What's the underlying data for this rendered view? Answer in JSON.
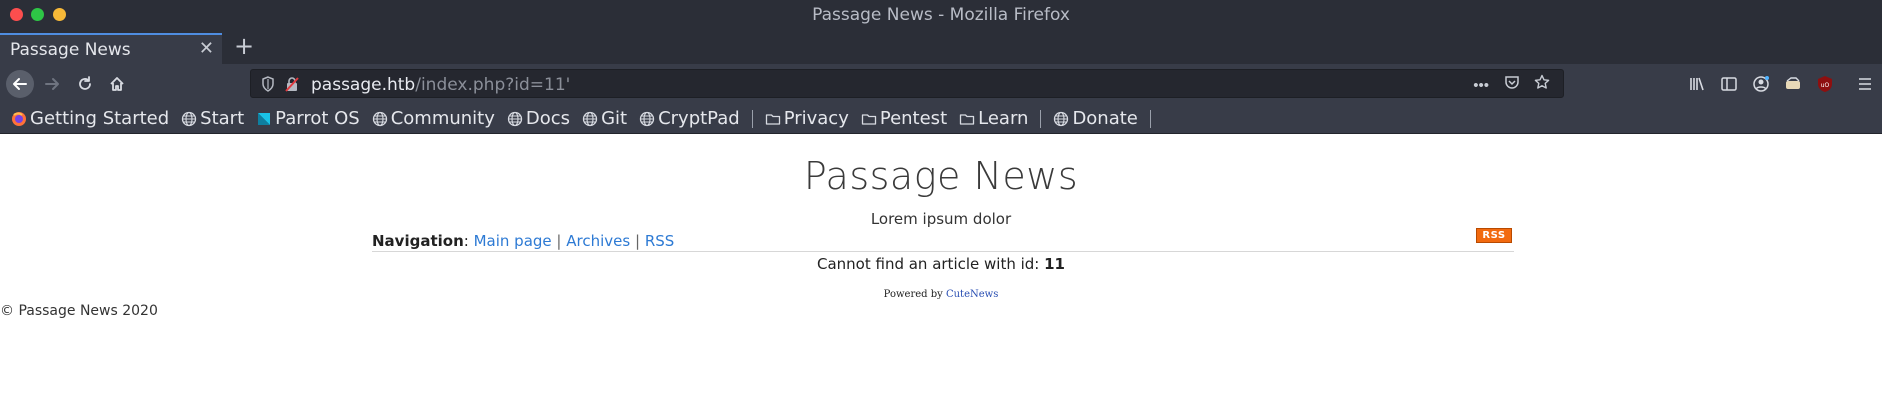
{
  "window": {
    "title": "Passage News - Mozilla Firefox"
  },
  "tab": {
    "title": "Passage News",
    "close_glyph": "✕",
    "new_tab_glyph": "+"
  },
  "toolbar": {
    "url_host": "passage.htb",
    "url_path": "/index.php?id=11'",
    "page_actions_glyph": "•••"
  },
  "bookmarks": {
    "items": [
      {
        "label": "Getting Started",
        "icon": "firefox-icon"
      },
      {
        "label": "Start",
        "icon": "globe-icon"
      },
      {
        "label": "Parrot OS",
        "icon": "parrot-icon"
      },
      {
        "label": "Community",
        "icon": "globe-icon"
      },
      {
        "label": "Docs",
        "icon": "globe-icon"
      },
      {
        "label": "Git",
        "icon": "globe-icon"
      },
      {
        "label": "CryptPad",
        "icon": "globe-icon"
      },
      {
        "label": "Privacy",
        "icon": "folder-icon"
      },
      {
        "label": "Pentest",
        "icon": "folder-icon"
      },
      {
        "label": "Learn",
        "icon": "folder-icon"
      },
      {
        "label": "Donate",
        "icon": "globe-icon"
      }
    ]
  },
  "page": {
    "site_title": "Passage News",
    "subtitle": "Lorem ipsum dolor",
    "nav_label": "Navigation",
    "nav_links": [
      "Main page",
      "Archives",
      "RSS"
    ],
    "rss_badge": "RSS",
    "error_prefix": "Cannot find an article with id: ",
    "error_id": "11",
    "powered_prefix": "Powered by ",
    "powered_link": "CuteNews",
    "copyright": "© Passage News 2020"
  },
  "colors": {
    "chrome_bg": "#2b2e37",
    "toolbar_bg": "#383c48",
    "link": "#2d7ad4",
    "rss_orange": "#f26a0f",
    "tab_accent": "#4f8de0"
  }
}
